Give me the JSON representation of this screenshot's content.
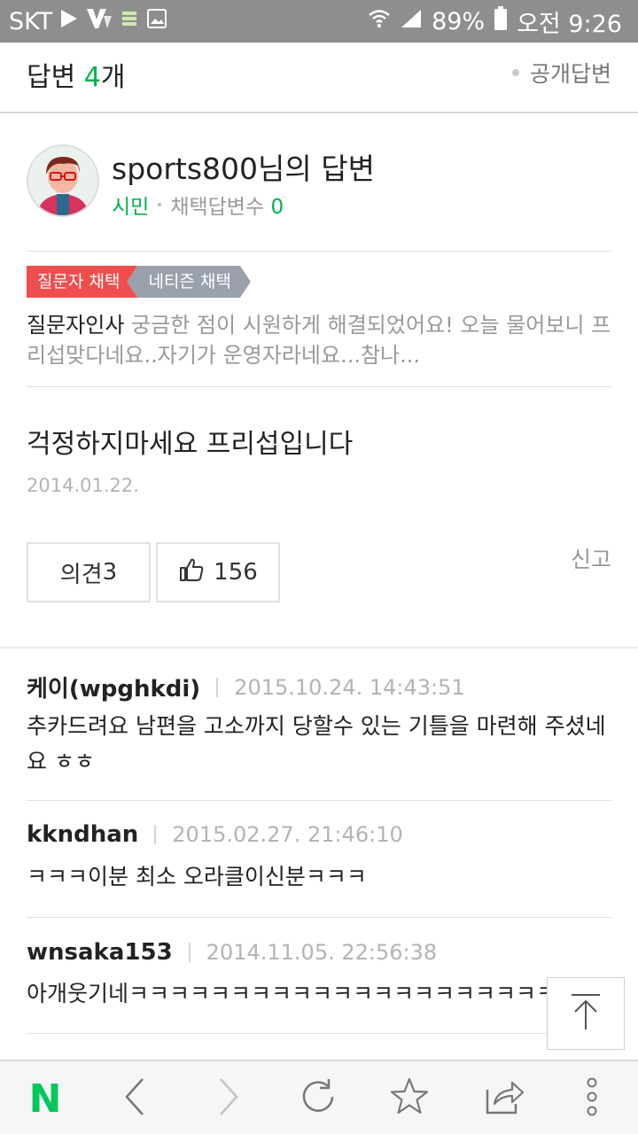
{
  "status_bar": {
    "carrier": "SKT",
    "battery": "89%",
    "time": "오전 9:26"
  },
  "header": {
    "title_prefix": "답변",
    "count": "4",
    "title_suffix": "개",
    "public_label": "공개답변"
  },
  "answer": {
    "author_title": "sports800님의 답변",
    "rank": "시민",
    "adopt_label": "채택답변수",
    "adopt_count": "0",
    "badge_asker": "질문자 채택",
    "badge_netizen": "네티즌 채택",
    "thanks_label": "질문자인사",
    "thanks_text": " 궁금한 점이 시원하게 해결되었어요! 오늘 물어보니 프리섭맞다네요..자기가 운영자라네요...참나...",
    "body": "걱정하지마세요 프리섭입니다",
    "date": "2014.01.22.",
    "opinion_label": "의견",
    "opinion_count": "3",
    "like_count": "156",
    "report_label": "신고"
  },
  "comments": [
    {
      "user": "케이(wpghkdi)",
      "time": "2015.10.24. 14:43:51",
      "text": "추카드려요 남편을 고소까지 당할수 있는 기틀을 마련해 주셨네요 ㅎㅎ"
    },
    {
      "user": "kkndhan",
      "time": "2015.02.27. 21:46:10",
      "text": "ㅋㅋㅋ이분 최소 오라클이신분ㅋㅋㅋ"
    },
    {
      "user": "wnsaka153",
      "time": "2014.11.05. 22:56:38",
      "text": "아개웃기네ㅋㅋㅋㅋㅋㅋㅋㅋㅋㅋㅋㅋㅋㅋㅋㅋㅋㅋㅋㅋㅋㅋㅋㅋㅋ"
    }
  ],
  "bottom_bar": {
    "home_letter": "N",
    "brand_color": "#03c75a"
  },
  "colors": {
    "accent_green": "#03b14e",
    "badge_red": "#f04e4e",
    "badge_gray": "#9aa1ad"
  }
}
